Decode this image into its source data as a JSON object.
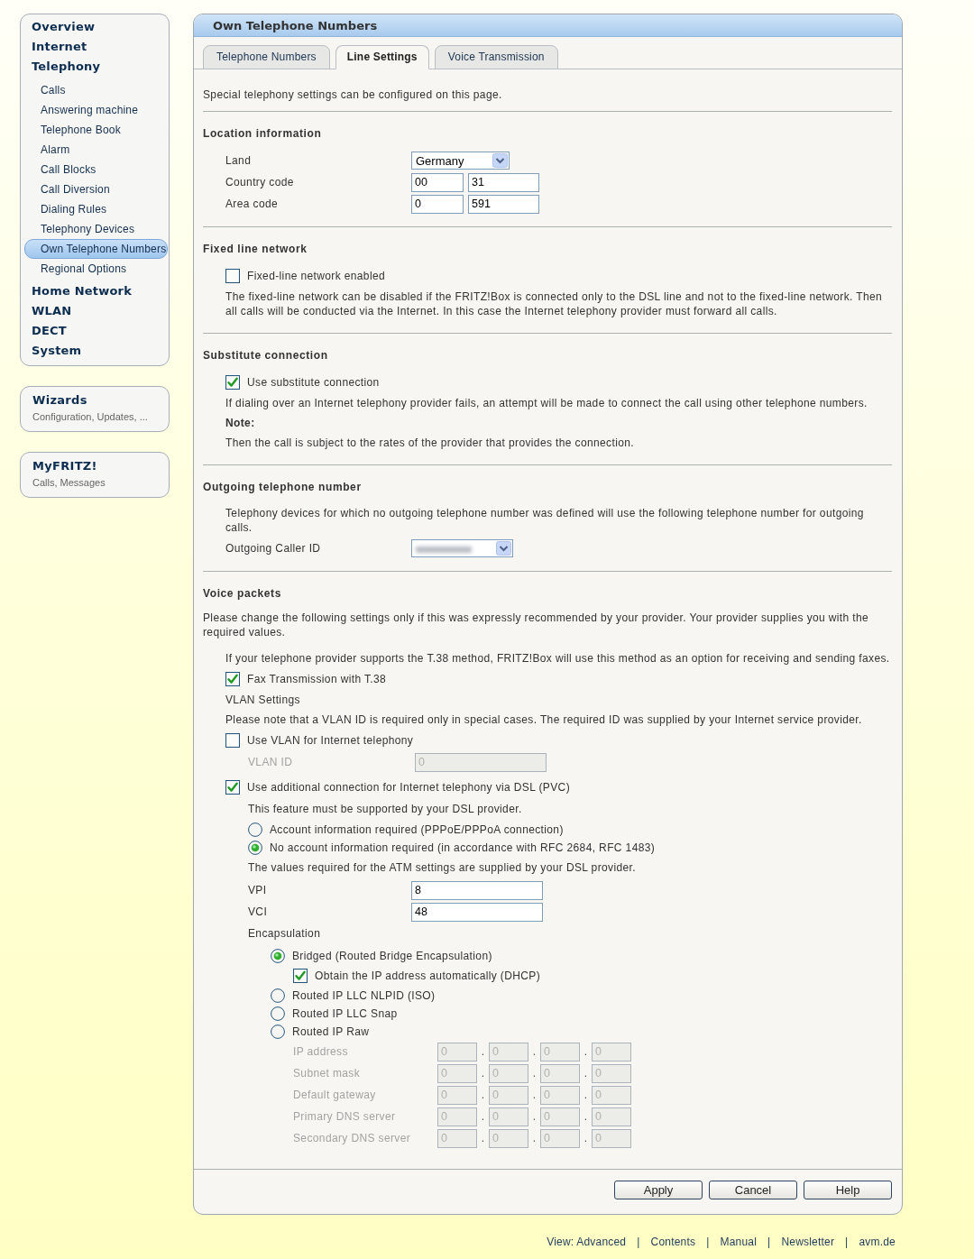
{
  "sidebar": {
    "menu": [
      {
        "label": "Overview",
        "selected": false
      },
      {
        "label": "Internet",
        "selected": false
      },
      {
        "label": "Telephony",
        "selected": false,
        "children": [
          {
            "label": "Calls",
            "selected": false
          },
          {
            "label": "Answering machine",
            "selected": false
          },
          {
            "label": "Telephone Book",
            "selected": false
          },
          {
            "label": "Alarm",
            "selected": false
          },
          {
            "label": "Call Blocks",
            "selected": false
          },
          {
            "label": "Call Diversion",
            "selected": false
          },
          {
            "label": "Dialing Rules",
            "selected": false
          },
          {
            "label": "Telephony Devices",
            "selected": false
          },
          {
            "label": "Own Telephone Numbers",
            "selected": true
          },
          {
            "label": "Regional Options",
            "selected": false
          }
        ]
      },
      {
        "label": "Home Network",
        "selected": false
      },
      {
        "label": "WLAN",
        "selected": false
      },
      {
        "label": "DECT",
        "selected": false
      },
      {
        "label": "System",
        "selected": false
      }
    ]
  },
  "shortcuts": [
    {
      "title": "Wizards",
      "subtitle": "Configuration, Updates, ..."
    },
    {
      "title": "MyFRITZ!",
      "subtitle": "Calls, Messages"
    }
  ],
  "panel": {
    "title": "Own Telephone Numbers",
    "tabs": [
      {
        "label": "Telephone Numbers",
        "selected": false
      },
      {
        "label": "Line Settings",
        "selected": true
      },
      {
        "label": "Voice Transmission",
        "selected": false
      }
    ],
    "intro": "Special telephony settings can be configured on this page.",
    "sections": [
      {
        "title": "Location information",
        "items": [
          {
            "kind": "select",
            "label": "Land",
            "value": "Germany"
          },
          {
            "kind": "inputs",
            "label": "Country code",
            "values": [
              "00",
              "31"
            ]
          },
          {
            "kind": "inputs",
            "label": "Area code",
            "values": [
              "0",
              "591"
            ]
          }
        ]
      },
      {
        "title": "Fixed line network",
        "items": [
          {
            "kind": "checkbox",
            "label": "Fixed-line network enabled",
            "checked": false
          },
          {
            "kind": "text",
            "text": "The fixed-line network can be disabled if the FRITZ!Box is connected only to the DSL line and not to the fixed-line network. Then all calls will be conducted via the Internet. In this case the Internet telephony provider must forward all calls."
          }
        ]
      },
      {
        "title": "Substitute connection",
        "items": [
          {
            "kind": "checkbox",
            "label": "Use substitute connection",
            "checked": true
          },
          {
            "kind": "text",
            "text": "If dialing over an Internet telephony provider fails, an attempt will be made to connect the call using other telephone numbers."
          },
          {
            "kind": "note",
            "text": "Note:"
          },
          {
            "kind": "text",
            "text": "Then the call is subject to the rates of the provider that provides the connection."
          }
        ]
      },
      {
        "title": "Outgoing telephone number",
        "items": [
          {
            "kind": "text",
            "text": "Telephony devices for which no outgoing telephone number was defined will use the following telephone number for outgoing calls."
          },
          {
            "kind": "select",
            "label": "Outgoing Caller ID",
            "blurred": true
          }
        ]
      },
      {
        "title": "Voice packets",
        "description": "Please change the following settings only if this was expressly recommended by your provider. Your provider supplies you with the required values.",
        "items": [
          {
            "kind": "text",
            "text": "If your telephone provider supports the T.38 method, FRITZ!Box will use this method as an option for receiving and sending faxes."
          },
          {
            "kind": "checkbox",
            "label": "Fax Transmission with T.38",
            "checked": true
          },
          {
            "kind": "text",
            "text": "VLAN Settings"
          },
          {
            "kind": "text",
            "text": "Please note that a VLAN ID is required only in special cases. The required ID was supplied by your Internet service provider."
          },
          {
            "kind": "checkbox",
            "label": "Use VLAN for Internet telephony",
            "checked": false,
            "children": [
              {
                "kind": "input",
                "label": "VLAN ID",
                "value": "0",
                "disabled": true
              }
            ]
          },
          {
            "kind": "checkbox",
            "label": "Use additional connection for Internet telephony via DSL (PVC)",
            "checked": true,
            "children": [
              {
                "kind": "text",
                "text": "This feature must be supported by your DSL provider."
              },
              {
                "kind": "radio",
                "label": "Account information required (PPPoE/PPPoA connection)",
                "selected": false
              },
              {
                "kind": "radio",
                "label": "No account information required (in accordance with RFC 2684, RFC 1483)",
                "selected": true
              },
              {
                "kind": "text",
                "text": "The values required for the ATM settings are supplied by your DSL provider."
              },
              {
                "kind": "input",
                "label": "VPI",
                "value": "8",
                "disabled": false
              },
              {
                "kind": "input",
                "label": "VCI",
                "value": "48",
                "disabled": false
              },
              {
                "kind": "text",
                "text": "Encapsulation",
                "children": [
                  {
                    "kind": "radio",
                    "label": "Bridged (Routed Bridge Encapsulation)",
                    "selected": true,
                    "children": [
                      {
                        "kind": "checkbox",
                        "label": "Obtain the IP address automatically (DHCP)",
                        "checked": true
                      }
                    ]
                  },
                  {
                    "kind": "radio",
                    "label": "Routed IP LLC NLPID (ISO)",
                    "selected": false
                  },
                  {
                    "kind": "radio",
                    "label": "Routed IP LLC Snap",
                    "selected": false
                  },
                  {
                    "kind": "radio",
                    "label": "Routed IP Raw",
                    "selected": false
                  },
                  {
                    "kind": "group",
                    "children": [
                      {
                        "kind": "ip",
                        "label": "IP address",
                        "values": [
                          "0",
                          "0",
                          "0",
                          "0"
                        ],
                        "separators": [
                          ".",
                          ".",
                          "."
                        ],
                        "disabled": true
                      },
                      {
                        "kind": "ip",
                        "label": "Subnet mask",
                        "values": [
                          "0",
                          "0",
                          "0",
                          "0"
                        ],
                        "separators": [
                          ".",
                          ".",
                          "."
                        ],
                        "disabled": true
                      },
                      {
                        "kind": "ip",
                        "label": "Default gateway",
                        "values": [
                          "0",
                          "0",
                          "0",
                          "0"
                        ],
                        "separators": [
                          ".",
                          ".",
                          "."
                        ],
                        "disabled": true
                      },
                      {
                        "kind": "ip",
                        "label": "Primary DNS server",
                        "values": [
                          "0",
                          "0",
                          "0",
                          "0"
                        ],
                        "separators": [
                          ".",
                          ".",
                          "."
                        ],
                        "disabled": true
                      },
                      {
                        "kind": "ip",
                        "label": "Secondary DNS server",
                        "values": [
                          "0",
                          "0",
                          "0",
                          "0"
                        ],
                        "separators": [
                          ".",
                          ".",
                          "."
                        ],
                        "disabled": true
                      }
                    ]
                  }
                ]
              }
            ]
          }
        ]
      }
    ],
    "buttons": [
      "Apply",
      "Cancel",
      "Help"
    ]
  },
  "footer": {
    "links": [
      "View: Advanced",
      "Contents",
      "Manual",
      "Newsletter",
      "avm.de"
    ],
    "separators": [
      "|",
      "|",
      "|",
      "|"
    ]
  }
}
